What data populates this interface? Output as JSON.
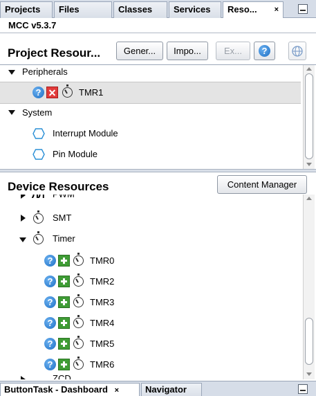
{
  "top_tabs": [
    {
      "label": "Projects"
    },
    {
      "label": "Files"
    },
    {
      "label": "Classes"
    },
    {
      "label": "Services"
    },
    {
      "label": "Reso...",
      "close": "×",
      "active": true
    }
  ],
  "version": "MCC v5.3.7",
  "project_resources": {
    "title": "Project Resour...",
    "buttons": {
      "generate": "Gener...",
      "import": "Impo...",
      "export": "Ex..."
    },
    "tree": {
      "peripherals": {
        "label": "Peripherals",
        "children": [
          {
            "label": "TMR1"
          }
        ]
      },
      "system": {
        "label": "System",
        "children": [
          {
            "label": "Interrupt Module"
          },
          {
            "label": "Pin Module"
          }
        ]
      }
    }
  },
  "device_resources": {
    "title": "Device Resources",
    "content_manager": "Content Manager",
    "items": [
      {
        "label": "PWM",
        "icon": "pwm-icon"
      },
      {
        "label": "SMT",
        "icon": "timer-icon"
      },
      {
        "label": "Timer",
        "icon": "timer-icon"
      }
    ],
    "timers": [
      "TMR0",
      "TMR2",
      "TMR3",
      "TMR4",
      "TMR5",
      "TMR6"
    ],
    "partial_last": "ZCD"
  },
  "bottom_tabs": [
    {
      "label": "ButtonTask - Dashboard",
      "close": "×",
      "active": true
    },
    {
      "label": "Navigator"
    }
  ],
  "colors": {
    "accent_blue": "#1d6fc4",
    "add_green": "#3f9c35",
    "remove_red": "#e23b3b"
  }
}
